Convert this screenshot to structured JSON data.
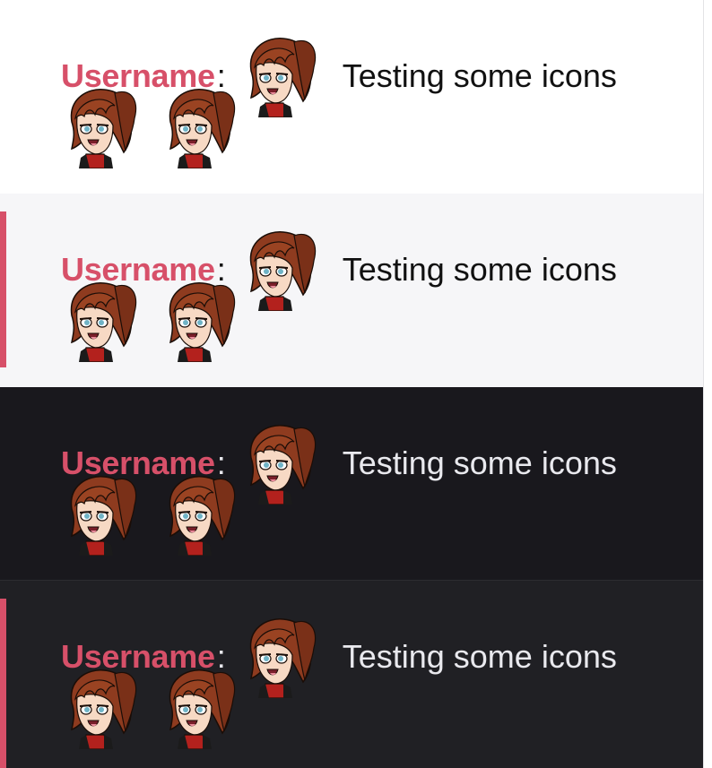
{
  "messages": [
    {
      "username": "Username",
      "separator": ":",
      "text": "Testing some icons",
      "theme": "light",
      "highlighted": false,
      "background": "#ffffff"
    },
    {
      "username": "Username",
      "separator": ":",
      "text": "Testing some icons",
      "theme": "light",
      "highlighted": true,
      "background": "#f6f6f8"
    },
    {
      "username": "Username",
      "separator": ":",
      "text": "Testing some icons",
      "theme": "dark",
      "highlighted": false,
      "background": "#19181d"
    },
    {
      "username": "Username",
      "separator": ":",
      "text": "Testing some icons",
      "theme": "dark",
      "highlighted": true,
      "background": "#202024"
    }
  ],
  "colors": {
    "username": "#d75069",
    "highlight_bar": "#d75069",
    "emote_hair": "#8e3b1f",
    "emote_shirt": "#b3211d"
  },
  "emote": {
    "icon": "anime-girl-emote-icon"
  }
}
